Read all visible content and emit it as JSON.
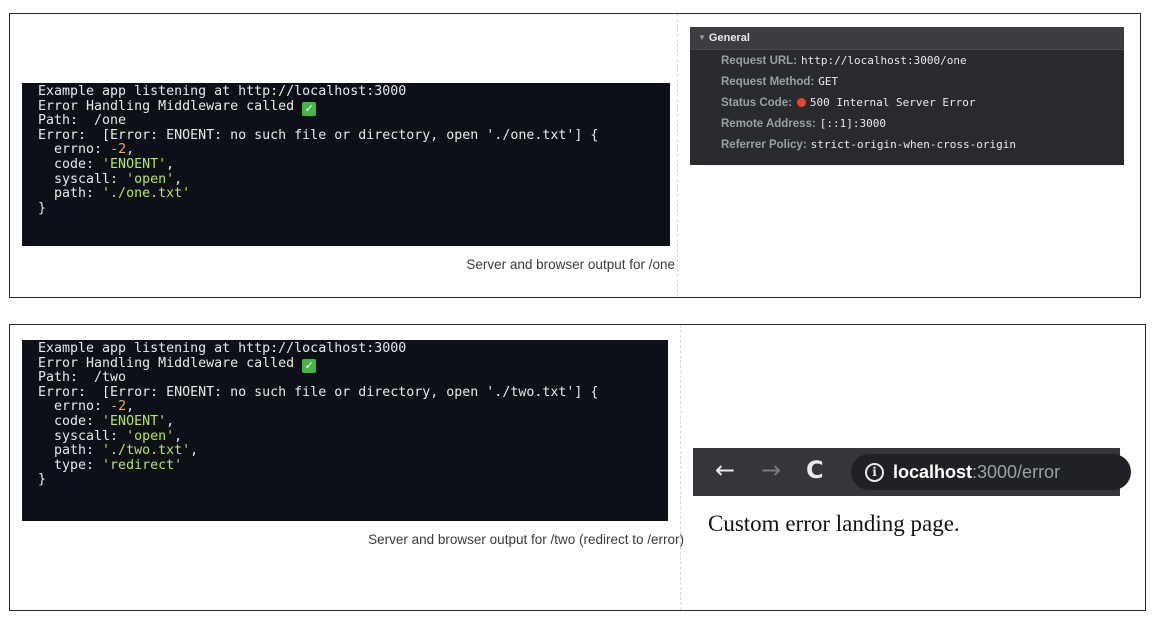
{
  "figure_one": {
    "terminal_lines": [
      [
        {
          "t": "Example app listening at http://localhost:3000"
        }
      ],
      [
        {
          "t": "Error Handling Middleware called "
        },
        {
          "check": true
        }
      ],
      [
        {
          "t": "Path:  /one"
        }
      ],
      [
        {
          "t": "Error:  [Error: ENOENT: no such file or directory, open './one.txt'] {"
        }
      ],
      [
        {
          "t": "  errno: "
        },
        {
          "t": "-2",
          "c": "num"
        },
        {
          "t": ","
        }
      ],
      [
        {
          "t": "  code: "
        },
        {
          "t": "'ENOENT'",
          "c": "str"
        },
        {
          "t": ","
        }
      ],
      [
        {
          "t": "  syscall: "
        },
        {
          "t": "'open'",
          "c": "str"
        },
        {
          "t": ","
        }
      ],
      [
        {
          "t": "  path: "
        },
        {
          "t": "'./one.txt'",
          "c": "str"
        }
      ],
      [
        {
          "t": "}"
        }
      ]
    ],
    "caption": "Server and browser output for /one",
    "devtools": {
      "section_title": "General",
      "rows": [
        {
          "key": "Request URL:",
          "value": "http://localhost:3000/one"
        },
        {
          "key": "Request Method:",
          "value": "GET"
        },
        {
          "key": "Status Code:",
          "value": "500 Internal Server Error",
          "status_dot_color": "#e8442e"
        },
        {
          "key": "Remote Address:",
          "value": "[::1]:3000"
        },
        {
          "key": "Referrer Policy:",
          "value": "strict-origin-when-cross-origin"
        }
      ]
    }
  },
  "figure_two": {
    "terminal_lines": [
      [
        {
          "t": "Example app listening at http://localhost:3000"
        }
      ],
      [
        {
          "t": "Error Handling Middleware called "
        },
        {
          "check": true
        }
      ],
      [
        {
          "t": "Path:  /two"
        }
      ],
      [
        {
          "t": "Error:  [Error: ENOENT: no such file or directory, open './two.txt'] {"
        }
      ],
      [
        {
          "t": "  errno: "
        },
        {
          "t": "-2",
          "c": "num"
        },
        {
          "t": ","
        }
      ],
      [
        {
          "t": "  code: "
        },
        {
          "t": "'ENOENT'",
          "c": "str"
        },
        {
          "t": ","
        }
      ],
      [
        {
          "t": "  syscall: "
        },
        {
          "t": "'open'",
          "c": "str"
        },
        {
          "t": ","
        }
      ],
      [
        {
          "t": "  path: "
        },
        {
          "t": "'./two.txt'",
          "c": "str"
        },
        {
          "t": ","
        }
      ],
      [
        {
          "t": "  type: "
        },
        {
          "t": "'redirect'",
          "c": "str"
        }
      ],
      [
        {
          "t": "}"
        }
      ]
    ],
    "caption": "Server and browser output for /two (redirect to /error)",
    "browser": {
      "back_icon": "←",
      "forward_icon": "→",
      "reload_icon": "C",
      "info_icon": "i",
      "url_host": "localhost",
      "url_rest": ":3000/error",
      "page_text": "Custom error landing page."
    }
  },
  "colors": {
    "terminal_bg": "#0d1117",
    "number": "#f2a65a",
    "string": "#b6e36b",
    "check_green": "#47b648"
  }
}
